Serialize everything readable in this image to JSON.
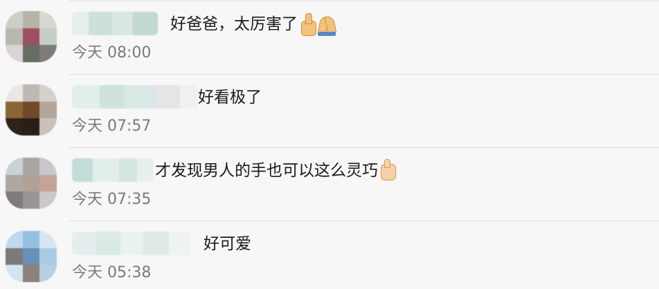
{
  "comments": [
    {
      "text": "好爸爸，太厉害了",
      "emojis": [
        "thumbs-up-icon",
        "folded-hands-icon"
      ],
      "time": "今天 08:00",
      "avatar_colors": [
        "#c9cfc9",
        "#b7b3a8",
        "#d8d7d2",
        "#b8b9ae",
        "#9e4e64",
        "#c6cec8",
        "#d9d2d6",
        "#6a6b62",
        "#7f7a78"
      ],
      "name_colors": [
        "#e6efec",
        "#cfe0dc",
        "#d9e6e3",
        "#c2d8d3"
      ]
    },
    {
      "text": "好看极了",
      "emojis": [],
      "time": "今天 07:57",
      "avatar_colors": [
        "#e9e6e3",
        "#bfb9b3",
        "#d6d0cb",
        "#8a6538",
        "#6f4b2b",
        "#b3a598",
        "#2e2219",
        "#2a1e16",
        "#c9c1b9"
      ],
      "name_colors": [
        "#e3eeec",
        "#cfe2dd",
        "#d9e8e5",
        "#e5e5e8",
        "#f0f0f0"
      ]
    },
    {
      "text": "才发现男人的手也可以这么灵巧",
      "emojis": [
        "thumbs-up-icon"
      ],
      "time": "今天 07:35",
      "avatar_colors": [
        "#cbd2d6",
        "#a9a7a6",
        "#c8c8cc",
        "#aea7a2",
        "#b0a196",
        "#c3a496",
        "#7e7a79",
        "#9a9494",
        "#cdc8c8"
      ],
      "name_colors": [
        "#c4dcd9",
        "#e2eeec",
        "#d2e5e1",
        "#e8f0ef"
      ]
    },
    {
      "text": "好可爱",
      "emojis": [],
      "time": "今天 05:38",
      "avatar_colors": [
        "#bcd9ef",
        "#96bfe1",
        "#d5e6f2",
        "#7a7b79",
        "#6a8fb8",
        "#aac9e3",
        "#d5e4ef",
        "#8d8179",
        "#b7cfe1"
      ],
      "name_colors": [
        "#e5eeee",
        "#d9e9e6",
        "#eaf2f0",
        "#dfeae8",
        "#edf3f2"
      ]
    }
  ]
}
